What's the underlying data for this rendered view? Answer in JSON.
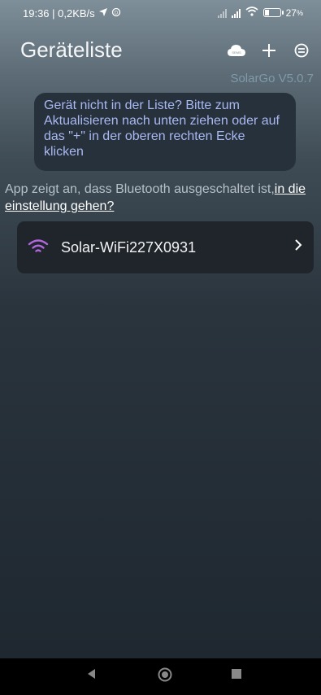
{
  "status": {
    "time_speed": "19:36 | 0,2KB/s",
    "battery": "27"
  },
  "header": {
    "title": "Geräteliste",
    "version": "SolarGo V5.0.7"
  },
  "hint": {
    "text": "Gerät nicht in der Liste? Bitte zum Aktualisieren nach unten ziehen oder auf das \"+\" in der oberen rechten Ecke klicken"
  },
  "bluetooth": {
    "text": "App zeigt an, dass Bluetooth ausgeschaltet ist,",
    "link": "in die einstellung gehen?"
  },
  "devices": [
    {
      "name": "Solar-WiFi227X0931"
    }
  ],
  "icons": {
    "cloud": "cloud-icon",
    "add": "plus-icon",
    "menu": "menu-icon",
    "wifi": "wifi-icon",
    "chevron": "chevron-right-icon"
  },
  "colors": {
    "accent": "#aab8f2",
    "wifi": "#b266e0"
  }
}
